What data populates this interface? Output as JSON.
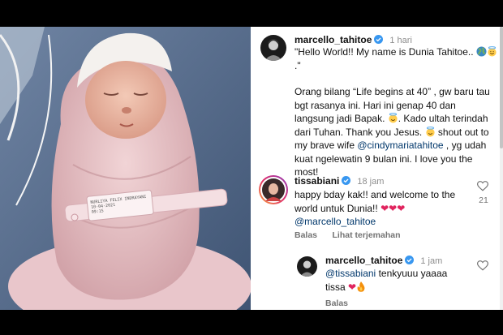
{
  "post": {
    "username": "marcello_tahitoe",
    "time": "1 hari",
    "caption": {
      "p1": "\"Hello World!! My name is Dunia Tahitoe..",
      "p1b": ".\"",
      "p2a": "Orang bilang “Life begins at 40” , gw baru tau bgt rasanya ini. Hari ini genap 40 dan langsung jadi Bapak.",
      "p2b": ". Kado ultah terindah dari Tuhan. Thank you Jesus.",
      "p2c": " shout out to my brave wife ",
      "mention": "@cindymariatahitoe",
      "p2d": " , yg udah kuat ngelewatin 9 bulan ini. I love you the most!"
    }
  },
  "comments": [
    {
      "username": "tissabiani",
      "time": "18 jam",
      "text": "happy bday kak!! and welcome to the world untuk Dunia!!",
      "mention": "@marcello_tahitoe",
      "likes": "21",
      "reply_label": "Balas",
      "translate_label": "Lihat terjemahan"
    },
    {
      "username": "marcello_tahitoe",
      "time": "1 jam",
      "mention": "@tissabiani",
      "text": "tenkyuuu yaaaa tissa",
      "reply_label": "Balas"
    }
  ],
  "photo": {
    "wristband_text": [
      "NURLIYA  FELIX INDRAYANI",
      "10-04-2021",
      "09:15"
    ]
  },
  "colors": {
    "verified": "#3897f0",
    "heart_red": "#e0245e",
    "mention": "#00376b",
    "photo_wrap": "#e8c3c7"
  },
  "icons": [
    "verified-icon",
    "globe-emoji-icon",
    "halo-smile-emoji-icon",
    "heart-outline-icon",
    "red-heart-emoji-icon",
    "fire-emoji-icon"
  ]
}
